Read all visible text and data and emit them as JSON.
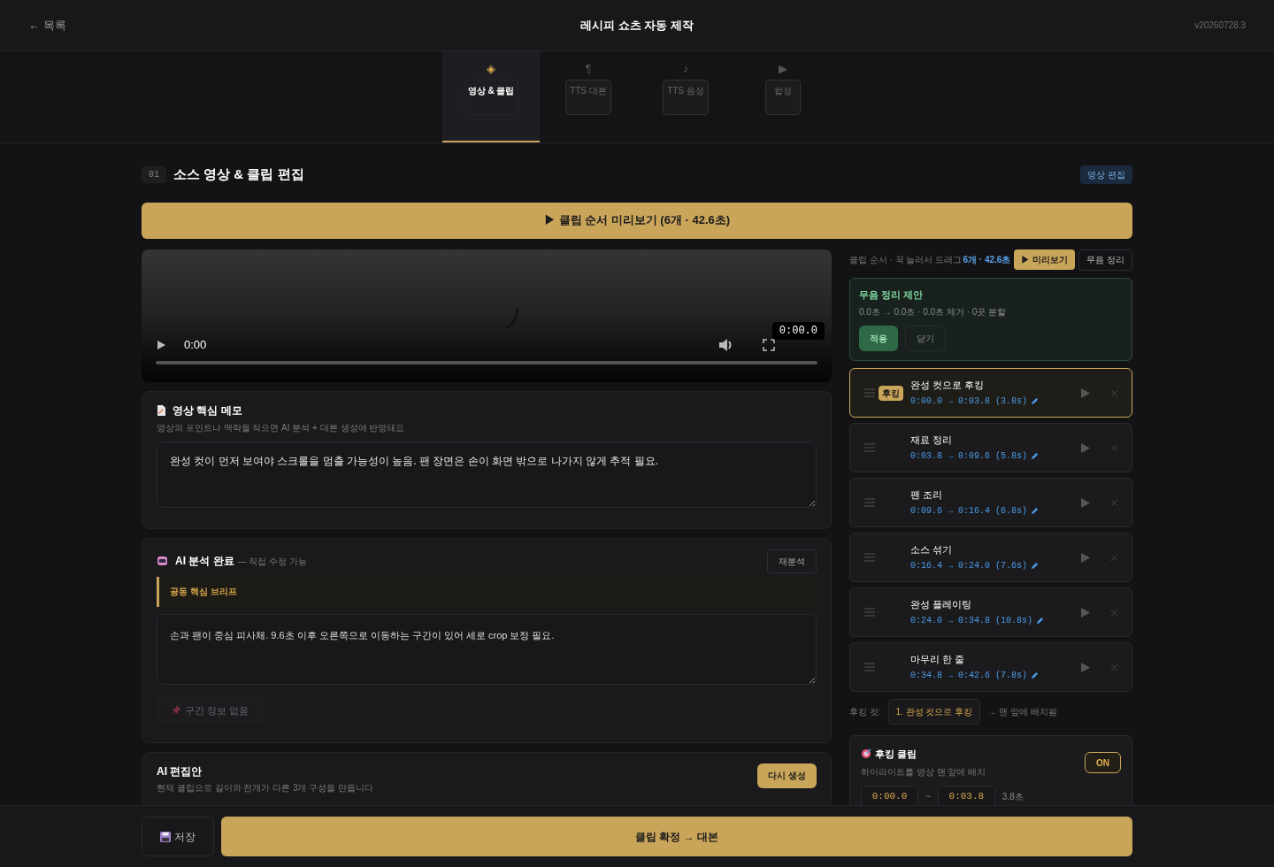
{
  "header": {
    "back": "← 목록",
    "title": "레시피 쇼츠 자동 제작",
    "version": "v20260728.3"
  },
  "steps": [
    {
      "icon": "◈",
      "label": "영상 & 클립",
      "selected": true
    },
    {
      "icon": "¶",
      "label": "TTS 대본",
      "selected": false
    },
    {
      "icon": "♪",
      "label": "TTS 음성",
      "selected": false
    },
    {
      "icon": "▶",
      "label": "합성",
      "selected": false
    }
  ],
  "section": {
    "number": "01",
    "title": "소스 영상 & 클립 편집",
    "tag": "영상 편집"
  },
  "preview_button": "▶ 클립 순서 미리보기 (6개 · 42.6초)",
  "video": {
    "time": "0:00",
    "overlay_time": "0:00.0"
  },
  "memo": {
    "title": "영상 핵심 메모",
    "hint": "영상의 포인트나 맥락을 적으면 AI 분석 + 대본 생성에 반영돼요",
    "value": "완성 컷이 먼저 보여야 스크롤을 멈출 가능성이 높음. 팬 장면은 손이 화면 밖으로 나가지 않게 추적 필요."
  },
  "analysis": {
    "title": "AI 분석 완료",
    "subtitle": "— 직접 수정 가능",
    "reanalyze": "재분석",
    "brief_label": "공동 핵심 브리프",
    "value": "손과 팬이 중심 피사체. 9.6초 이후 오른쪽으로 이동하는 구간이 있어 세로 crop 보정 필요.",
    "segment_button": {
      "label": "구간 정보 없음",
      "disabled": true
    }
  },
  "edit_plan": {
    "title": "AI 편집안",
    "hint": "현재 클립으로 길이와 전개가 다른 3개 구성을 만듭니다",
    "regenerate": "다시 생성"
  },
  "clip_panel": {
    "label": "클립 순서 · 꾹 눌러서 드래그",
    "summary": "6개 · 42.6초",
    "preview": "▶ 미리보기",
    "silence": "무음 정리"
  },
  "silence_suggestion": {
    "title": "무음 정리 제안",
    "detail": "0.0초 → 0.0초 · 0.0초 제거 · 0곳 분할",
    "apply": "적용",
    "close": "닫기"
  },
  "clips": [
    {
      "badge": "후킹",
      "title": "완성 컷으로 후킹",
      "range": "0:00.0 → 0:03.8 (3.8s)",
      "selected": true
    },
    {
      "title": "재료 정리",
      "range": "0:03.8 → 0:09.6 (5.8s)",
      "selected": false
    },
    {
      "title": "팬 조리",
      "range": "0:09.6 → 0:16.4 (6.8s)",
      "selected": false
    },
    {
      "title": "소스 섞기",
      "range": "0:16.4 → 0:24.0 (7.6s)",
      "selected": false
    },
    {
      "title": "완성 플레이팅",
      "range": "0:24.0 → 0:34.8 (10.8s)",
      "selected": false
    },
    {
      "title": "마무리 한 줄",
      "range": "0:34.8 → 0:42.6 (7.8s)",
      "selected": false
    }
  ],
  "hook_select": {
    "label": "후킹 컷:",
    "value": "1. 완성 컷으로 후킹",
    "note": "→ 맨 앞에 배치됨"
  },
  "hook_clip": {
    "title": "후킹 클립",
    "hint": "하이라이트를 영상 맨 앞에 배치",
    "toggle": {
      "label": "ON",
      "on": true
    },
    "start": "0:00.0",
    "separator": "~",
    "end": "0:03.8",
    "duration": "3.8초"
  },
  "footer": {
    "save": "저장",
    "confirm": "클립 확정 → 대본"
  }
}
